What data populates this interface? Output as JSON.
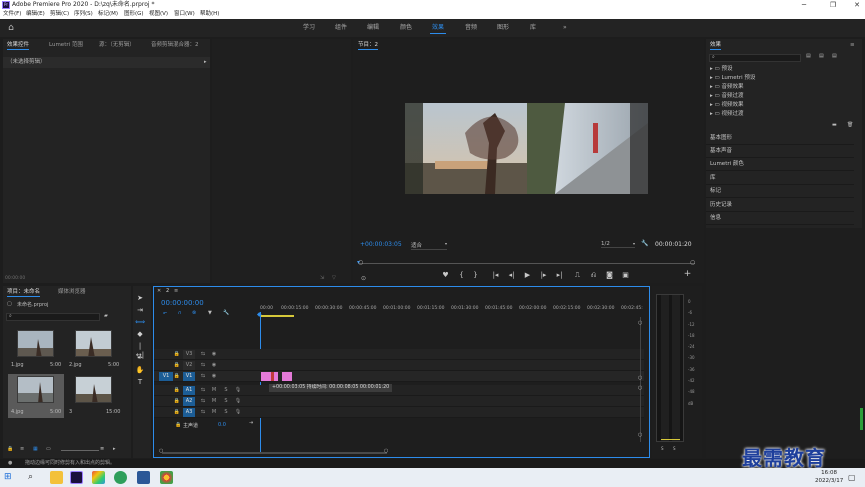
{
  "window": {
    "title": "Adobe Premiere Pro 2020 - D:\\zq\\未命名.prproj *",
    "logo": "Pr",
    "controls": [
      "─",
      "❐",
      "✕"
    ]
  },
  "menu": [
    "文件(F)",
    "编辑(E)",
    "剪辑(C)",
    "序列(S)",
    "标记(M)",
    "图形(G)",
    "视图(V)",
    "窗口(W)",
    "帮助(H)"
  ],
  "workspaces": {
    "items": [
      "学习",
      "组件",
      "编辑",
      "颜色",
      "效果",
      "音频",
      "图形",
      "库"
    ],
    "active": "效果",
    "more": "»"
  },
  "source_panel": {
    "tabs": [
      "效果控件",
      "Lumetri 范围",
      "源：（无剪辑）",
      "音频剪辑混合器：2"
    ],
    "no_clip": "（未选择剪辑）",
    "timecode": "00:00:00"
  },
  "program": {
    "tab": "节目：2",
    "timecode": "+00:00:03:05",
    "fit": "适合",
    "quality": "1/2",
    "duration": "00:00:01:20"
  },
  "project": {
    "tabs": [
      "项目：未命名",
      "媒体浏览器"
    ],
    "file": "未命名.prproj",
    "items": [
      {
        "name": "1.jpg",
        "dur": "5:00"
      },
      {
        "name": "2.jpg",
        "dur": "5:00"
      },
      {
        "name": "4.jpg",
        "dur": "5:00"
      },
      {
        "name": "3",
        "dur": "15:00"
      }
    ]
  },
  "timeline": {
    "tab": "2",
    "timecode": "00:00:00:00",
    "ruler": [
      "00:00",
      "00:00:15:00",
      "00:00:30:00",
      "00:00:45:00",
      "00:01:00:00",
      "00:01:15:00",
      "00:01:30:00",
      "00:01:45:00",
      "00:02:00:00",
      "00:02:15:00",
      "00:02:30:00",
      "00:02:45:"
    ],
    "video_tracks": [
      "V3",
      "V2",
      "V1"
    ],
    "audio_tracks": [
      "A1",
      "A2",
      "A3"
    ],
    "src_video": "V1",
    "master": "主声道",
    "master_val": "0.0",
    "tooltip": "+00:00:03:05 持续时间: 00:00:08:05 00:00:01:20",
    "track_buttons": {
      "mute": "M",
      "solo": "S"
    }
  },
  "meter": {
    "scale": [
      "0",
      "-6",
      "-12",
      "-18",
      "-24",
      "-30",
      "-36",
      "-42",
      "-48",
      "dB"
    ],
    "footer": [
      "S",
      "S"
    ]
  },
  "effects": {
    "title": "效果",
    "folders": [
      "预设",
      "Lumetri 预设",
      "音频效果",
      "音频过渡",
      "视频效果",
      "视频过渡"
    ],
    "panels": [
      "基本图形",
      "基本声音",
      "Lumetri 颜色",
      "库",
      "标记",
      "历史记录",
      "信息"
    ]
  },
  "status": "拖动边缘可同时修剪有入和出点的剪辑。",
  "taskbar": {
    "time": "16:08",
    "date": "2022/3/17",
    "watermark": "最需教育"
  },
  "colors": {
    "accent": "#2d8ceb",
    "clip": "#e47ad8",
    "track_on": "#1c5d96"
  }
}
